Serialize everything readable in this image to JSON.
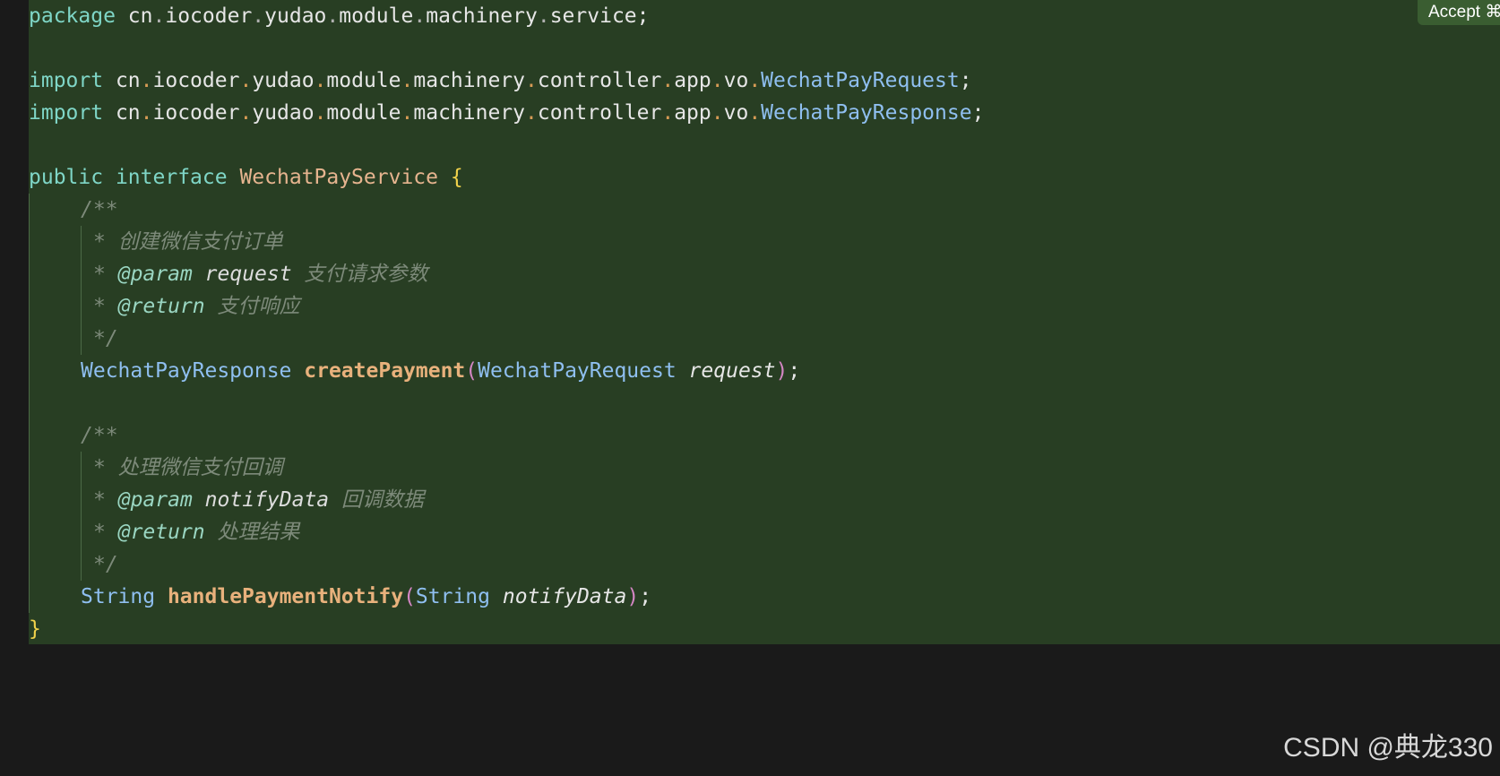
{
  "accept_button": {
    "label": "Accept ⌘"
  },
  "code": {
    "line1": {
      "kw": "package",
      "seg": [
        "cn",
        ".",
        "iocoder",
        ".",
        "yudao",
        ".",
        "module",
        ".",
        "machinery",
        ".",
        "service",
        ";"
      ]
    },
    "line3": {
      "kw": "import",
      "seg": [
        "cn",
        ".",
        "iocoder",
        ".",
        "yudao",
        ".",
        "module",
        ".",
        "machinery",
        ".",
        "controller",
        ".",
        "app",
        ".",
        "vo",
        ".",
        "WechatPayRequest",
        ";"
      ]
    },
    "line4": {
      "kw": "import",
      "seg": [
        "cn",
        ".",
        "iocoder",
        ".",
        "yudao",
        ".",
        "module",
        ".",
        "machinery",
        ".",
        "controller",
        ".",
        "app",
        ".",
        "vo",
        ".",
        "WechatPayResponse",
        ";"
      ]
    },
    "line6": {
      "kw1": "public",
      "kw2": "interface",
      "name": "WechatPayService",
      "brace": "{"
    },
    "doc1": {
      "open": "/**",
      "desc": "创建微信支付订单",
      "param_tag": "@param",
      "param_name": "request",
      "param_desc": "支付请求参数",
      "return_tag": "@return",
      "return_desc": "支付响应",
      "close": "*/"
    },
    "method1": {
      "ret": "WechatPayResponse",
      "name": "createPayment",
      "lp": "(",
      "ptype": "WechatPayRequest",
      "pname": "request",
      "rp": ")",
      "semi": ";"
    },
    "doc2": {
      "open": "/**",
      "desc": "处理微信支付回调",
      "param_tag": "@param",
      "param_name": "notifyData",
      "param_desc": "回调数据",
      "return_tag": "@return",
      "return_desc": "处理结果",
      "close": "*/"
    },
    "method2": {
      "ret": "String",
      "name": "handlePaymentNotify",
      "lp": "(",
      "ptype": "String",
      "pname": "notifyData",
      "rp": ")",
      "semi": ";"
    },
    "closing_brace": "}",
    "star": "*"
  },
  "watermark": "CSDN @典龙330",
  "colors": {
    "background": "#1a1a1a",
    "diff_added_bg": "#283e23",
    "keyword": "#7fd6c7",
    "type": "#8fbff0",
    "function": "#e8b17c",
    "comment": "#7d8a7a"
  }
}
